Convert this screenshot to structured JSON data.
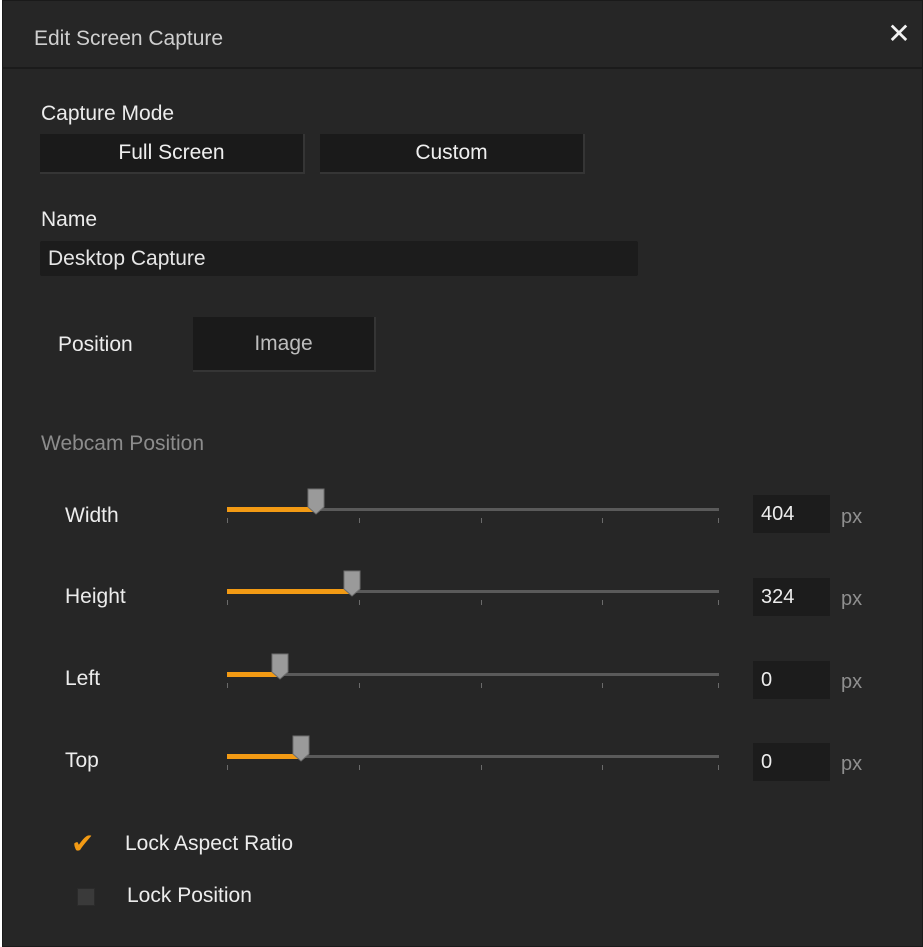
{
  "window": {
    "title": "Edit Screen Capture",
    "close_icon": "close-icon"
  },
  "capture_mode": {
    "label": "Capture Mode",
    "buttons": [
      "Full Screen",
      "Custom"
    ]
  },
  "name": {
    "label": "Name",
    "value": "Desktop Capture"
  },
  "position": {
    "label": "Position",
    "button": "Image"
  },
  "webcam_position": {
    "label": "Webcam Position",
    "sliders": [
      {
        "label": "Width",
        "value": "404",
        "unit": "px",
        "fill_fraction": 0.18
      },
      {
        "label": "Height",
        "value": "324",
        "unit": "px",
        "fill_fraction": 0.25
      },
      {
        "label": "Left",
        "value": "0",
        "unit": "px",
        "fill_fraction": 0.1
      },
      {
        "label": "Top",
        "value": "0",
        "unit": "px",
        "fill_fraction": 0.15
      }
    ]
  },
  "options": {
    "lock_aspect_ratio": {
      "label": "Lock Aspect Ratio",
      "checked": true
    },
    "lock_position": {
      "label": "Lock Position",
      "checked": false
    }
  },
  "colors": {
    "accent": "#f29a14",
    "background": "#262626"
  }
}
